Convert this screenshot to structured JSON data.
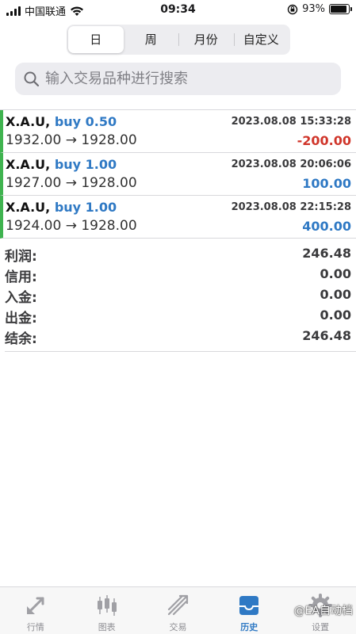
{
  "status_bar": {
    "carrier": "中国联通",
    "time": "09:34",
    "battery_text": "93%",
    "battery_level": 0.93
  },
  "period_tabs": [
    {
      "label": "日",
      "active": true
    },
    {
      "label": "周",
      "active": false
    },
    {
      "label": "月份",
      "active": false
    },
    {
      "label": "自定义",
      "active": false
    }
  ],
  "search": {
    "placeholder": "输入交易品种进行搜索"
  },
  "trades": [
    {
      "symbol": "X.A.U,",
      "side": "buy 0.50",
      "time": "2023.08.08 15:33:28",
      "prices": "1932.00 → 1928.00",
      "profit": "-200.00",
      "profit_color": "#d0362b"
    },
    {
      "symbol": "X.A.U,",
      "side": "buy 1.00",
      "time": "2023.08.08 20:06:06",
      "prices": "1927.00 → 1928.00",
      "profit": "100.00",
      "profit_color": "#2f79c4"
    },
    {
      "symbol": "X.A.U,",
      "side": "buy 1.00",
      "time": "2023.08.08 22:15:28",
      "prices": "1924.00 → 1928.00",
      "profit": "400.00",
      "profit_color": "#2f79c4"
    }
  ],
  "summary": [
    {
      "label": "利润:",
      "value": "246.48"
    },
    {
      "label": "信用:",
      "value": "0.00"
    },
    {
      "label": "入金:",
      "value": "0.00"
    },
    {
      "label": "出金:",
      "value": "0.00"
    },
    {
      "label": "结余:",
      "value": "246.48"
    }
  ],
  "tabbar": [
    {
      "label": "行情",
      "icon": "quotes-icon",
      "active": false
    },
    {
      "label": "图表",
      "icon": "chart-icon",
      "active": false
    },
    {
      "label": "交易",
      "icon": "trade-icon",
      "active": false
    },
    {
      "label": "历史",
      "icon": "history-icon",
      "active": true
    },
    {
      "label": "设置",
      "icon": "settings-icon",
      "active": false
    }
  ],
  "watermark": "@EA自动档",
  "colors": {
    "accent": "#2f79c4",
    "loss": "#d0362b",
    "trade_marker": "#3fb34f"
  }
}
